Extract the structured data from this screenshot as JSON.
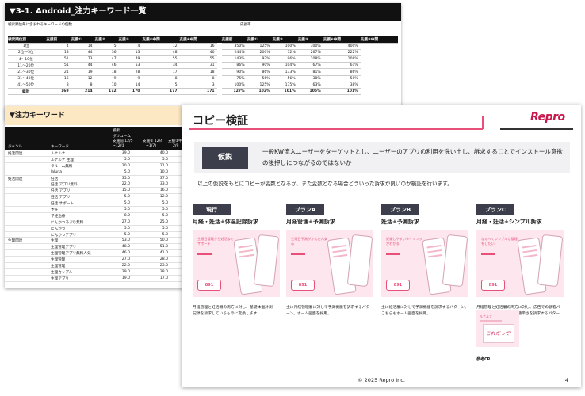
{
  "sheet1": {
    "title": "▼3-1. Android_注力キーワード一覧",
    "left_caption": "検索順位毎に含まれるキーワードの個数",
    "right_caption": "成長率",
    "headers": [
      "検索順位別",
      "支援前",
      "支援①",
      "支援②",
      "支援③",
      "支援④中間",
      "支援④中間",
      "支援前",
      "支援①",
      "支援②",
      "支援③",
      "支援④中間",
      "支援④中間"
    ],
    "rows": [
      [
        "1位",
        "4",
        "14",
        "5",
        "4",
        "12",
        "16",
        "350%",
        "125%",
        "100%",
        "300%",
        "400%"
      ],
      [
        "2位〜5位",
        "18",
        "44",
        "36",
        "13",
        "48",
        "40",
        "244%",
        "200%",
        "72%",
        "267%",
        "222%"
      ],
      [
        "4〜10位",
        "51",
        "73",
        "47",
        "49",
        "55",
        "55",
        "143%",
        "92%",
        "96%",
        "108%",
        "108%"
      ],
      [
        "11〜20位",
        "51",
        "44",
        "46",
        "53",
        "34",
        "31",
        "86%",
        "90%",
        "104%",
        "67%",
        "61%"
      ],
      [
        "21〜30位",
        "21",
        "19",
        "18",
        "28",
        "17",
        "18",
        "90%",
        "86%",
        "133%",
        "81%",
        "86%"
      ],
      [
        "31〜40位",
        "16",
        "12",
        "9",
        "9",
        "8",
        "8",
        "75%",
        "56%",
        "56%",
        "38%",
        "50%"
      ],
      [
        "41〜50位",
        "8",
        "8",
        "10",
        "14",
        "5",
        "3",
        "100%",
        "125%",
        "175%",
        "63%",
        "38%"
      ]
    ],
    "total": [
      "総計",
      "169",
      "214",
      "172",
      "170",
      "177",
      "171",
      "127%",
      "102%",
      "101%",
      "105%",
      "101%"
    ]
  },
  "sheet2": {
    "title": "▼注力キーワード",
    "col_labels": {
      "search": "検索",
      "volume": "ボリューム",
      "support_before": "支援前 12/5",
      "support_a": "支援① 12/4",
      "support_b": "支援②中間",
      "range_a": "~12/②",
      "range_b": "~1/7)",
      "range_c": "2/9",
      "genre": "ジャンル",
      "keyword": "キーワード"
    },
    "rows": [
      {
        "genre": "妊活関連",
        "keyword": "ルナルナ",
        "v1": "39.0",
        "v2": "40.0"
      },
      {
        "genre": "",
        "keyword": "ルナルナ 生理",
        "v1": "5.0",
        "v2": "5.0"
      },
      {
        "genre": "",
        "keyword": "ラルーム無料",
        "v1": "20.0",
        "v2": "21.0"
      },
      {
        "genre": "",
        "keyword": "laluna",
        "v1": "5.0",
        "v2": "10.0"
      },
      {
        "genre": "妊活関連",
        "keyword": "妊活",
        "v1": "35.0",
        "v2": "37.0"
      },
      {
        "genre": "",
        "keyword": "妊活 アプリ無料",
        "v1": "22.0",
        "v2": "33.0"
      },
      {
        "genre": "",
        "keyword": "妊活 アプリ",
        "v1": "15.0",
        "v2": "16.0"
      },
      {
        "genre": "",
        "keyword": "妊活 アプリ",
        "v1": "5.0",
        "v2": "12.0"
      },
      {
        "genre": "",
        "keyword": "妊活 サポート",
        "v1": "5.0",
        "v2": "5.0"
      },
      {
        "genre": "",
        "keyword": "予妊",
        "v1": "5.0",
        "v2": "5.0"
      },
      {
        "genre": "",
        "keyword": "予妊治療",
        "v1": "8.0",
        "v2": "5.0"
      },
      {
        "genre": "",
        "keyword": "にんかつあぷり無料",
        "v1": "27.0",
        "v2": "25.0"
      },
      {
        "genre": "",
        "keyword": "にんかつ",
        "v1": "5.0",
        "v2": "5.0"
      },
      {
        "genre": "",
        "keyword": "にんかつアプリ",
        "v1": "5.0",
        "v2": "5.0"
      },
      {
        "genre": "生理関連",
        "keyword": "生理",
        "v1": "53.0",
        "v2": "50.0"
      },
      {
        "genre": "",
        "keyword": "生理管理アプリ",
        "v1": "48.0",
        "v2": "51.0"
      },
      {
        "genre": "",
        "keyword": "生理管理アプリ無料人気",
        "v1": "46.0",
        "v2": "41.0"
      },
      {
        "genre": "",
        "keyword": "生理管理",
        "v1": "27.0",
        "v2": "28.0"
      },
      {
        "genre": "",
        "keyword": "生理管理",
        "v1": "22.0",
        "v2": "23.0"
      },
      {
        "genre": "",
        "keyword": "生理カップル",
        "v1": "29.0",
        "v2": "28.0"
      },
      {
        "genre": "",
        "keyword": "生理アプリ",
        "v1": "19.0",
        "v2": "17.0"
      }
    ]
  },
  "slide": {
    "title": "コピー検証",
    "logo": "Repro",
    "hypothesis_badge": "仮説",
    "hypothesis_text": "一般KW流入ユーザーをターゲットとし、ユーザーのアプリの利用を洗い出し、訴求することでインストール意欲の後押しにつながるのではないか",
    "intro": "以上の仮説をもとにコピーが変数となるか、また変数となる場合どういった訴求が良いのか検証を行います。",
    "plans": [
      {
        "badge": "現行",
        "name": "月経・妊活+体温記録訴求",
        "img_text": "生理日管理から妊活までサポート",
        "price": "891",
        "desc": "月経管理と妊活機の両方に対し、基礎体温計測・記録を訴求しているものに変換します"
      },
      {
        "badge": "プランA",
        "name": "月経管理+予測訴求",
        "img_text": "生理日予測がかんたん安心",
        "price": "891",
        "desc": "主に月経管理層に対して予測機能を訴求するパターン。ホーム画面を採用。"
      },
      {
        "badge": "プランB",
        "name": "妊活+予測訴求",
        "img_text": "妊娠しやすいタイミングがわかる",
        "price": "891",
        "desc": "主に妊活層に対して予測機能を訴求するパターン。こちらもホーム画面を採用。"
      },
      {
        "badge": "プランC",
        "name": "月経・妊活+シンプル訴求",
        "img_text": "なるべくシンプルな管理をしたい",
        "price": "891",
        "desc": "月経管理と妊活層の両方に対し、広告での顧客パターンであるシンプル・簡単さを訴求するパターン。入力画面面を採用。"
      }
    ],
    "ref_brand": "ルナルナ",
    "ref_script": "これだって!",
    "ref_label": "参考CR",
    "footer": "© 2025 Repro Inc.",
    "page_number": "4"
  }
}
